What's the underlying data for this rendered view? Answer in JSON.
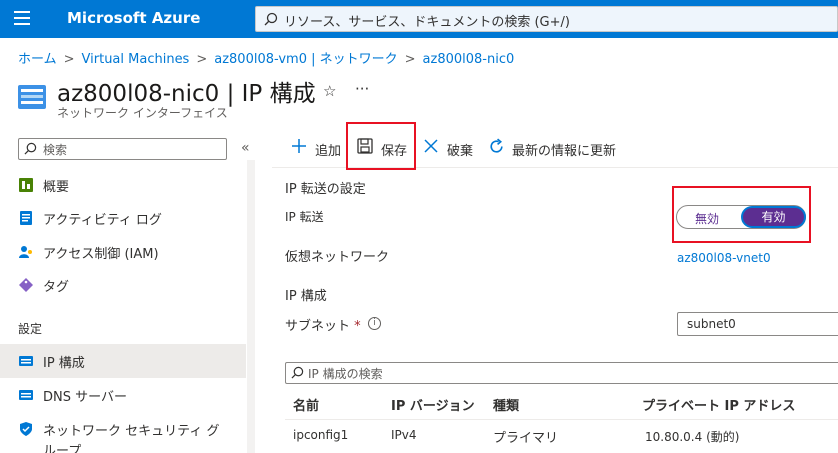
{
  "topbar": {
    "brand": "Microsoft Azure",
    "search_placeholder": "リソース、サービス、ドキュメントの検索 (G+/)"
  },
  "breadcrumb": [
    "ホーム",
    "Virtual Machines",
    "az800l08-vm0 | ネットワーク",
    "az800l08-nic0"
  ],
  "header": {
    "title": "az800l08-nic0 | IP 構成",
    "subtitle": "ネットワーク インターフェイス",
    "star": "☆",
    "more": "···"
  },
  "sidebar": {
    "search_placeholder": "検索",
    "collapse": "«",
    "items": [
      {
        "label": "概要",
        "icon": "overview-icon"
      },
      {
        "label": "アクティビティ ログ",
        "icon": "activity-log-icon"
      },
      {
        "label": "アクセス制御 (IAM)",
        "icon": "iam-icon"
      },
      {
        "label": "タグ",
        "icon": "tag-icon"
      }
    ],
    "section": "設定",
    "settings_items": [
      {
        "label": "IP 構成",
        "icon": "ip-config-icon",
        "active": true
      },
      {
        "label": "DNS サーバー",
        "icon": "dns-icon"
      },
      {
        "label": "ネットワーク セキュリティ グ",
        "icon": "nsg-icon"
      },
      {
        "label": "ループ",
        "icon": ""
      }
    ]
  },
  "toolbar": {
    "add": "追加",
    "save": "保存",
    "discard": "破棄",
    "refresh": "最新の情報に更新"
  },
  "content": {
    "ip_forwarding_section": "IP 転送の設定",
    "ip_forwarding_label": "IP 転送",
    "toggle_off": "無効",
    "toggle_on": "有効",
    "vnet_label": "仮想ネットワーク",
    "vnet_value": "az800l08-vnet0",
    "ip_config_section": "IP 構成",
    "subnet_label": "サブネット",
    "required_mark": "*",
    "info": "i",
    "subnet_value": "subnet0",
    "ip_search_placeholder": "IP 構成の検索"
  },
  "table": {
    "headers": [
      "名前",
      "IP バージョン",
      "種類",
      "プライベート IP アドレス"
    ],
    "rows": [
      [
        "ipconfig1",
        "IPv4",
        "プライマリ",
        "10.80.0.4 (動的)"
      ]
    ]
  },
  "colors": {
    "accent": "#0078d4",
    "toggle_on": "#5c2e91",
    "highlight": "#e81123"
  }
}
